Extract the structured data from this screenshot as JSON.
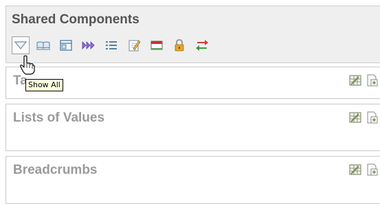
{
  "header": {
    "title": "Shared Components",
    "toolbar": [
      {
        "icon": "show-all-icon",
        "active": true
      },
      {
        "icon": "book-icon"
      },
      {
        "icon": "window-icon"
      },
      {
        "icon": "forward-icon"
      },
      {
        "icon": "list-icon"
      },
      {
        "icon": "edit-page-icon"
      },
      {
        "icon": "panel-icon"
      },
      {
        "icon": "lock-icon"
      },
      {
        "icon": "swap-arrows-icon"
      }
    ]
  },
  "tooltip": {
    "text": "Show All"
  },
  "panels": [
    {
      "title": "Ta",
      "actions": [
        "grid-edit-icon",
        "add-page-icon"
      ]
    },
    {
      "title": "Lists of Values",
      "actions": [
        "grid-edit-icon",
        "add-page-icon"
      ]
    },
    {
      "title": "Breadcrumbs",
      "actions": [
        "grid-edit-icon",
        "add-page-icon"
      ]
    }
  ],
  "colors": {
    "header_bg": "#efefef",
    "title_text": "#555555",
    "panel_title": "#9a9a9a",
    "tooltip_bg": "#ffffe1"
  }
}
